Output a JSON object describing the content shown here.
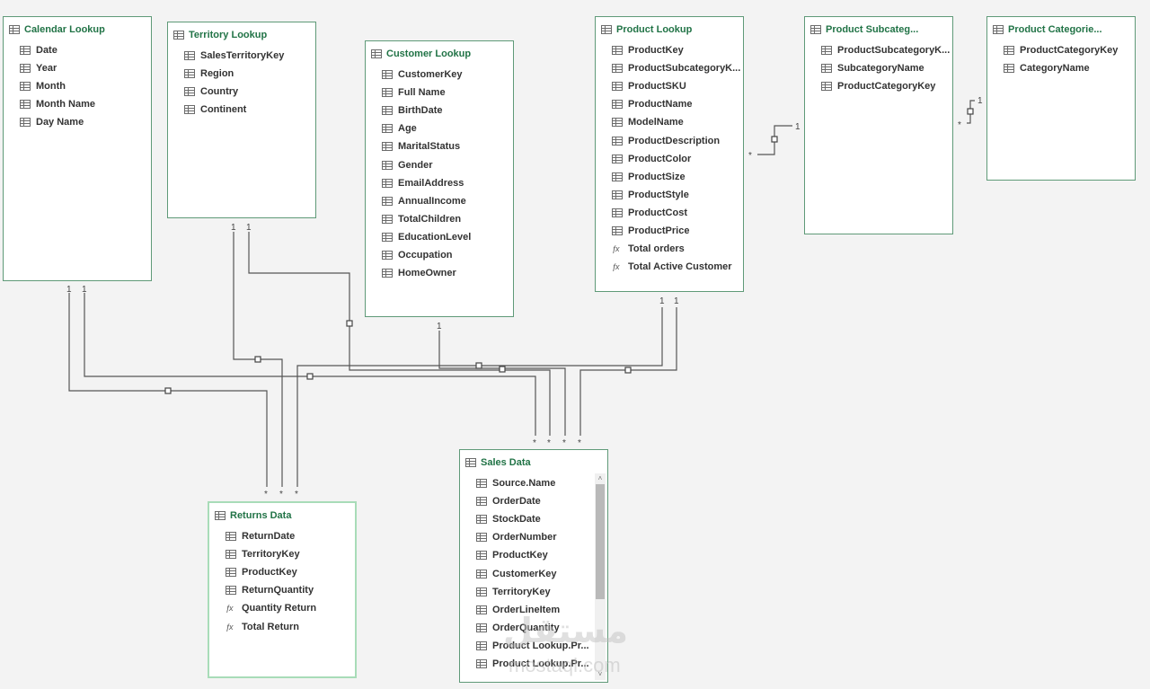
{
  "tables": {
    "calendar": {
      "title": "Calendar Lookup",
      "fields": [
        {
          "name": "Date"
        },
        {
          "name": "Year"
        },
        {
          "name": "Month"
        },
        {
          "name": "Month Name"
        },
        {
          "name": "Day Name"
        }
      ]
    },
    "territory": {
      "title": "Territory Lookup",
      "fields": [
        {
          "name": "SalesTerritoryKey"
        },
        {
          "name": "Region"
        },
        {
          "name": "Country"
        },
        {
          "name": "Continent"
        }
      ]
    },
    "customer": {
      "title": "Customer Lookup",
      "fields": [
        {
          "name": "CustomerKey"
        },
        {
          "name": "Full Name"
        },
        {
          "name": "BirthDate"
        },
        {
          "name": "Age"
        },
        {
          "name": "MaritalStatus"
        },
        {
          "name": "Gender"
        },
        {
          "name": "EmailAddress"
        },
        {
          "name": "AnnualIncome"
        },
        {
          "name": "TotalChildren"
        },
        {
          "name": "EducationLevel"
        },
        {
          "name": "Occupation"
        },
        {
          "name": "HomeOwner"
        }
      ]
    },
    "product": {
      "title": "Product Lookup",
      "fields": [
        {
          "name": "ProductKey"
        },
        {
          "name": "ProductSubcategoryK..."
        },
        {
          "name": "ProductSKU"
        },
        {
          "name": "ProductName"
        },
        {
          "name": "ModelName"
        },
        {
          "name": "ProductDescription"
        },
        {
          "name": "ProductColor"
        },
        {
          "name": "ProductSize"
        },
        {
          "name": "ProductStyle"
        },
        {
          "name": "ProductCost"
        },
        {
          "name": "ProductPrice"
        },
        {
          "name": "Total orders",
          "measure": true
        },
        {
          "name": "Total Active Customer",
          "measure": true
        }
      ]
    },
    "subcategory": {
      "title": "Product Subcateg...",
      "fields": [
        {
          "name": "ProductSubcategoryK..."
        },
        {
          "name": "SubcategoryName"
        },
        {
          "name": "ProductCategoryKey"
        }
      ]
    },
    "categories": {
      "title": "Product Categorie...",
      "fields": [
        {
          "name": "ProductCategoryKey"
        },
        {
          "name": "CategoryName"
        }
      ]
    },
    "returns": {
      "title": "Returns Data",
      "fields": [
        {
          "name": "ReturnDate"
        },
        {
          "name": "TerritoryKey"
        },
        {
          "name": "ProductKey"
        },
        {
          "name": "ReturnQuantity"
        },
        {
          "name": "Quantity Return",
          "measure": true
        },
        {
          "name": "Total Return",
          "measure": true
        }
      ]
    },
    "sales": {
      "title": "Sales Data",
      "fields": [
        {
          "name": "Source.Name"
        },
        {
          "name": "OrderDate"
        },
        {
          "name": "StockDate"
        },
        {
          "name": "OrderNumber"
        },
        {
          "name": "ProductKey"
        },
        {
          "name": "CustomerKey"
        },
        {
          "name": "TerritoryKey"
        },
        {
          "name": "OrderLineItem"
        },
        {
          "name": "OrderQuantity"
        },
        {
          "name": "Product Lookup.Pr..."
        },
        {
          "name": "Product Lookup.Pr..."
        }
      ]
    }
  },
  "relationships": [
    {
      "one": "Calendar Lookup",
      "many": "Sales Data",
      "one_label": "1",
      "many_label": "*"
    },
    {
      "one": "Calendar Lookup",
      "many": "Returns Data",
      "one_label": "1",
      "many_label": "*"
    },
    {
      "one": "Territory Lookup",
      "many": "Returns Data",
      "one_label": "1",
      "many_label": "*"
    },
    {
      "one": "Territory Lookup",
      "many": "Sales Data",
      "one_label": "1",
      "many_label": "*"
    },
    {
      "one": "Customer Lookup",
      "many": "Sales Data",
      "one_label": "1",
      "many_label": "*"
    },
    {
      "one": "Product Lookup",
      "many": "Sales Data",
      "one_label": "1",
      "many_label": "*"
    },
    {
      "one": "Product Lookup",
      "many": "Returns Data",
      "one_label": "1",
      "many_label": "*"
    },
    {
      "one": "Product Subcategories",
      "many": "Product Lookup",
      "one_label": "1",
      "many_label": "*"
    },
    {
      "one": "Product Categories",
      "many": "Product Subcategories",
      "one_label": "1",
      "many_label": "*"
    }
  ],
  "watermark": {
    "text": "مستقل",
    "url": "mostaql.com"
  },
  "colors": {
    "table_title": "#217346",
    "table_border": "#5f9a78",
    "selected_border": "#a8dcb8",
    "line": "#555555",
    "background": "#f3f3f3"
  },
  "icons": {
    "column": "table-column-icon",
    "measure": "fx-measure-icon",
    "table": "table-icon"
  }
}
